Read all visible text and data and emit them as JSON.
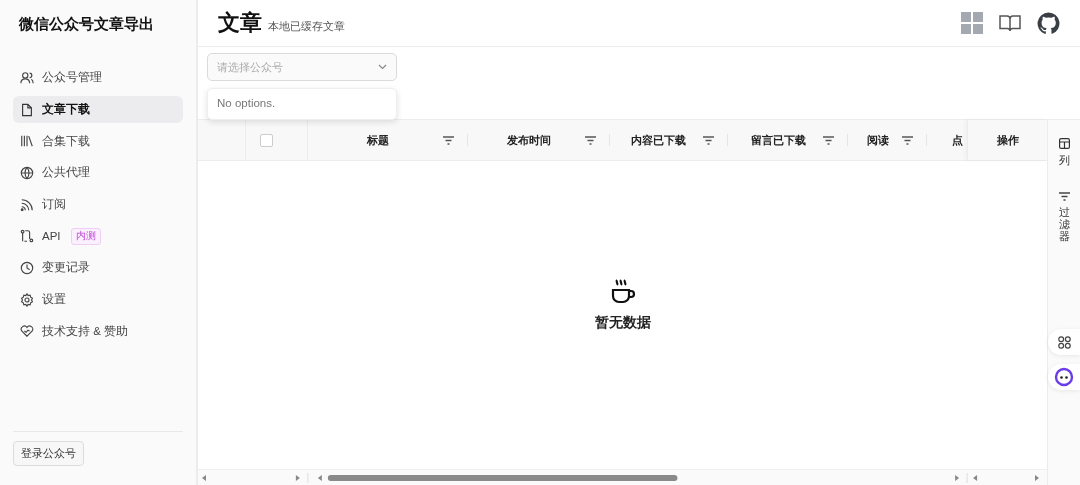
{
  "app_title": "微信公众号文章导出",
  "sidebar": {
    "items": [
      {
        "label": "公众号管理",
        "selected": false
      },
      {
        "label": "文章下载",
        "selected": true
      },
      {
        "label": "合集下载",
        "selected": false
      },
      {
        "label": "公共代理",
        "selected": false
      },
      {
        "label": "订阅",
        "selected": false
      },
      {
        "label": "API",
        "selected": false,
        "badge": "内测"
      },
      {
        "label": "变更记录",
        "selected": false
      },
      {
        "label": "设置",
        "selected": false
      },
      {
        "label": "技术支持 & 赞助",
        "selected": false
      }
    ],
    "login_button": "登录公众号"
  },
  "page": {
    "title": "文章",
    "subtitle": "本地已缓存文章"
  },
  "account_select": {
    "placeholder": "请选择公众号",
    "dropdown_message": "No options."
  },
  "table": {
    "columns": [
      {
        "kind": "blank"
      },
      {
        "kind": "checkbox",
        "checked": false
      },
      {
        "label": "标题",
        "kind": "text",
        "filter": true
      },
      {
        "label": "发布时间",
        "kind": "text",
        "filter": true
      },
      {
        "label": "内容已下载",
        "kind": "text",
        "filter": true
      },
      {
        "label": "留言已下载",
        "kind": "text",
        "filter": true
      },
      {
        "label": "阅读",
        "kind": "text",
        "filter": true
      },
      {
        "label": "点",
        "kind": "text",
        "filter": false
      },
      {
        "label": "操作",
        "kind": "pinned",
        "filter": false
      }
    ],
    "empty_message": "暂无数据"
  },
  "side_panel": [
    {
      "label": "列",
      "kind": "columns"
    },
    {
      "label": "过滤器",
      "kind": "filters"
    }
  ]
}
